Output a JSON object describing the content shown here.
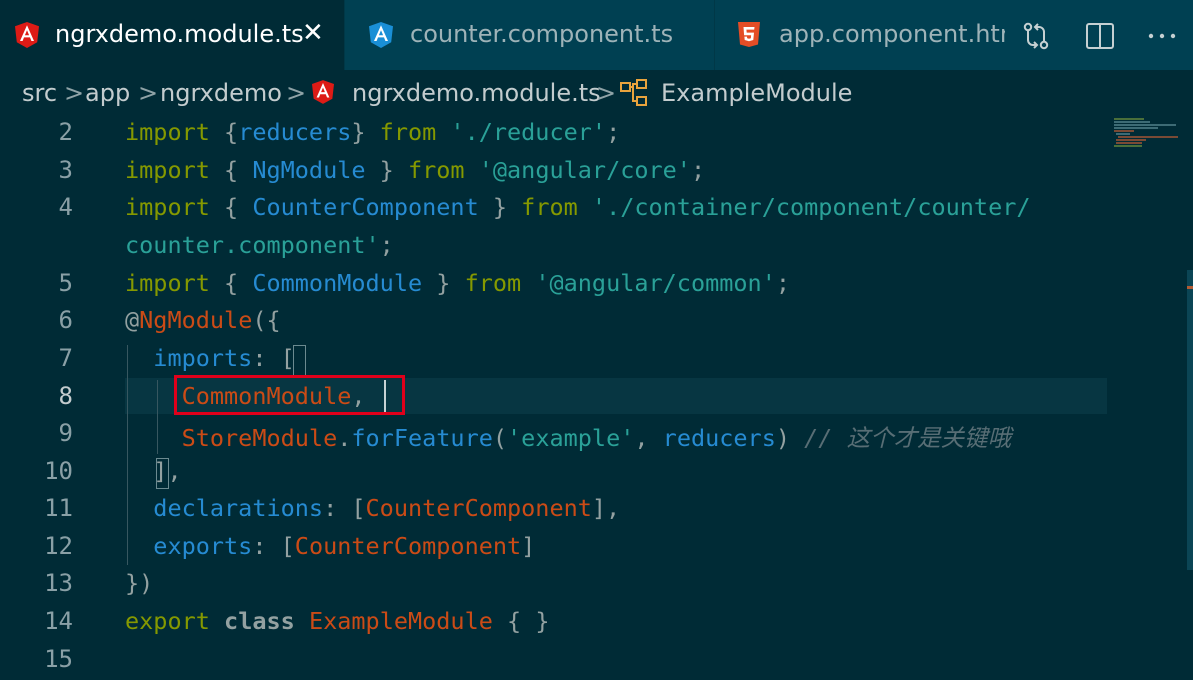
{
  "tabs": [
    {
      "label": "ngrxdemo.module.ts",
      "icon": "angular-icon",
      "active": true,
      "close": "✕"
    },
    {
      "label": "counter.component.ts",
      "icon": "angular-icon",
      "active": false
    },
    {
      "label": "app.component.htn",
      "icon": "html5-icon",
      "active": false
    }
  ],
  "toolbar_icons": [
    "compare-changes-icon",
    "split-editor-icon",
    "more-actions-icon"
  ],
  "breadcrumb": {
    "items": [
      "src",
      "app",
      "ngrxdemo",
      "ngrxdemo.module.ts",
      "ExampleModule"
    ],
    "separator": ">"
  },
  "editor": {
    "line_numbers": [
      "2",
      "3",
      "4",
      "",
      "5",
      "6",
      "7",
      "8",
      "9",
      "10",
      "11",
      "12",
      "13",
      "14",
      "15"
    ],
    "current_line": "8",
    "highlighted_token": "CommonModule,",
    "comment_text": "// 这个才是关键哦"
  },
  "colors": {
    "background": "#002b36",
    "tab_bar": "#004052",
    "keyword": "#859900",
    "string": "#2aa198",
    "identifier": "#268bd2",
    "class": "#cb4b16",
    "highlight_box": "#e0001b"
  }
}
